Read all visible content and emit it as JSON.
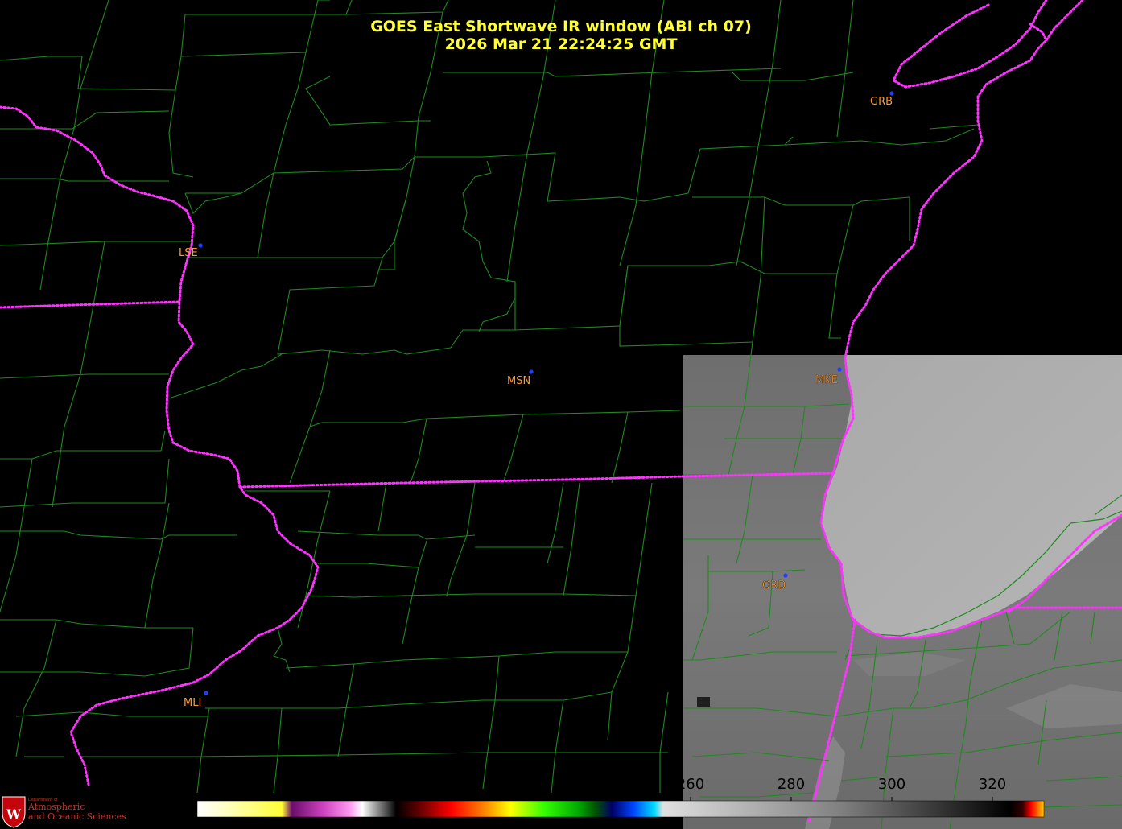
{
  "title": {
    "line1": "GOES East Shortwave IR window (ABI ch 07)",
    "line2": "2026 Mar 21  22:24:25 GMT"
  },
  "map": {
    "background_color": "#000000",
    "county_line_color": "#1f8a1f",
    "state_line_color": "#ff33ff",
    "station_dot_color": "#1f3fff",
    "label_color": "#ff9a2e",
    "stations": [
      {
        "id": "GRB",
        "label": "GRB"
      },
      {
        "id": "LSE",
        "label": "LSE"
      },
      {
        "id": "MSN",
        "label": "MSN"
      },
      {
        "id": "MKE",
        "label": "MKE"
      },
      {
        "id": "ORD",
        "label": "ORD"
      },
      {
        "id": "MLI",
        "label": "MLI"
      }
    ]
  },
  "colorbar": {
    "ticks": [
      "260",
      "280",
      "300",
      "320"
    ],
    "tick_values": [
      260,
      280,
      300,
      320
    ]
  },
  "logo": {
    "line1": "Department of",
    "line2": "Atmospheric",
    "line3": "and Oceanic Sciences"
  }
}
